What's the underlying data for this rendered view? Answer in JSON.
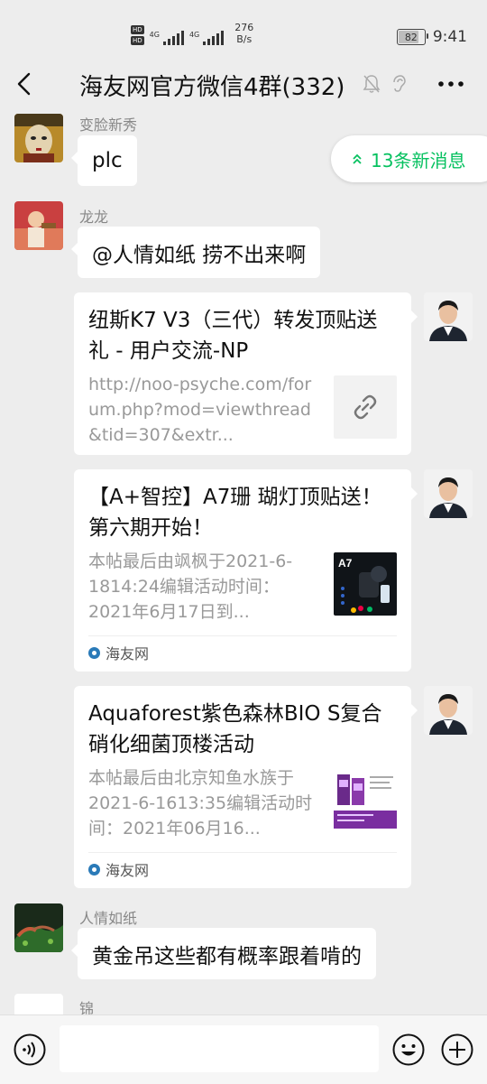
{
  "status_bar": {
    "hd1": "HD",
    "hd2": "HD",
    "net1": "4G",
    "net2": "4G",
    "speed_value": "276",
    "speed_unit": "B/s",
    "battery": "82",
    "time": "9:41"
  },
  "header": {
    "title": "海友网官方微信4群(332)"
  },
  "new_messages": {
    "label": "13条新消息"
  },
  "messages": [
    {
      "sender": "变脸新秀",
      "text": "plc"
    },
    {
      "sender": "龙龙",
      "text": "@人情如纸  捞不出来啊"
    },
    {
      "type": "link_card",
      "title": "纽斯K7 V3（三代）转发顶贴送礼 - 用户交流-NP",
      "desc": "http://noo-psyche.com/forum.php?mod=viewthread&tid=307&extr..."
    },
    {
      "type": "link_card",
      "title": "【A+智控】A7珊 瑚灯顶贴送！第六期开始！",
      "desc": "本帖最后由飒枫于2021-6-1814:24编辑活动时间：2021年6月17日到...",
      "source": "海友网",
      "thumb_label": "A7"
    },
    {
      "type": "link_card",
      "title": "Aquaforest紫色森林BIO S复合硝化细菌顶楼活动",
      "desc": "本帖最后由北京知鱼水族于2021-6-1613:35编辑活动时间：2021年06月16...",
      "source": "海友网"
    },
    {
      "sender": "人情如纸",
      "text": "黄金吊这些都有概率跟着啃的"
    },
    {
      "sender": "锦"
    }
  ],
  "input": {
    "value": ""
  },
  "colors": {
    "accent": "#07c160",
    "background": "#ededed"
  }
}
